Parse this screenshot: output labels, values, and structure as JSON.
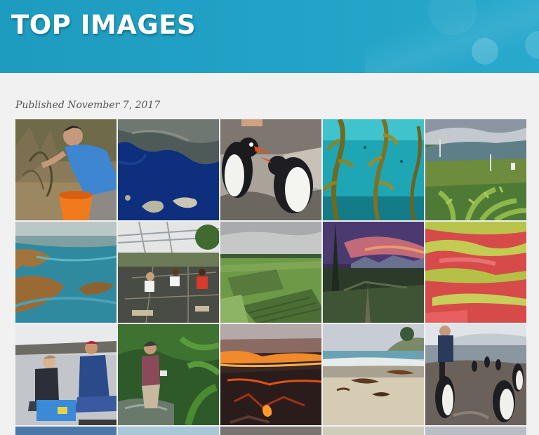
{
  "banner": {
    "title": "TOP IMAGES"
  },
  "meta": {
    "published": "Published November 7, 2017"
  },
  "gallery": {
    "images": [
      {
        "name": "researcher-planting-shrub-photo"
      },
      {
        "name": "satellite-islands-photo"
      },
      {
        "name": "gentoo-penguins-on-rocks-photo"
      },
      {
        "name": "kelp-forest-photo"
      },
      {
        "name": "hillside-ferns-station-photo"
      },
      {
        "name": "aerial-estuary-photo"
      },
      {
        "name": "field-plot-researchers-photo"
      },
      {
        "name": "crop-field-plots-photo"
      },
      {
        "name": "forest-sunset-photo"
      },
      {
        "name": "red-yellow-meadow-photo"
      },
      {
        "name": "researchers-ice-sampling-photo"
      },
      {
        "name": "stream-researcher-photo"
      },
      {
        "name": "prairie-burn-photo"
      },
      {
        "name": "kelp-beach-photo"
      },
      {
        "name": "penguin-colony-photo"
      }
    ]
  }
}
